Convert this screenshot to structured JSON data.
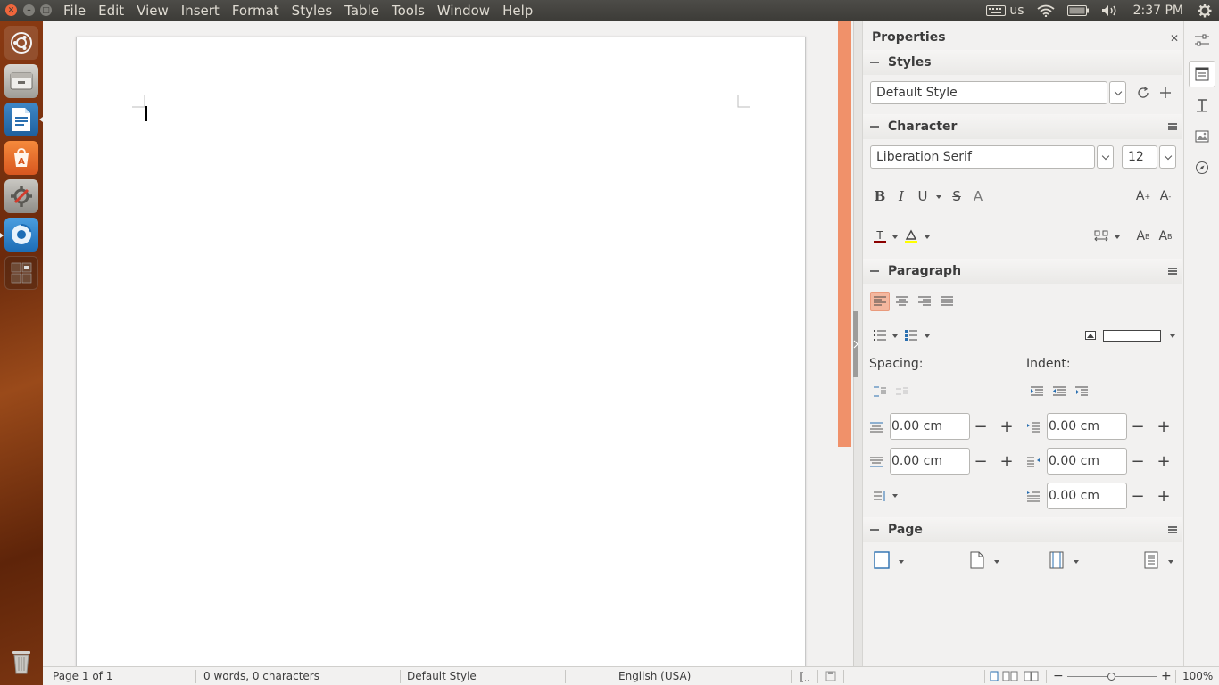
{
  "menubar": {
    "items": [
      "File",
      "Edit",
      "View",
      "Insert",
      "Format",
      "Styles",
      "Table",
      "Tools",
      "Window",
      "Help"
    ]
  },
  "indicators": {
    "keyboard_layout": "us",
    "clock": "2:37 PM"
  },
  "launcher": {
    "icons": [
      "ubuntu-dash-icon",
      "files-icon",
      "writer-icon",
      "software-center-icon",
      "system-settings-icon",
      "browser-icon",
      "workspace-switcher-icon",
      "trash-icon"
    ]
  },
  "sidebar": {
    "title": "Properties",
    "styles": {
      "header": "Styles",
      "value": "Default Style"
    },
    "character": {
      "header": "Character",
      "font": "Liberation Serif",
      "size": "12"
    },
    "paragraph": {
      "header": "Paragraph",
      "spacing_label": "Spacing:",
      "indent_label": "Indent:",
      "above_spacing": "0.00 cm",
      "below_spacing": "0.00 cm",
      "before_indent": "0.00 cm",
      "after_indent": "0.00 cm",
      "first_line_indent": "0.00 cm"
    },
    "page": {
      "header": "Page"
    }
  },
  "statusbar": {
    "page": "Page 1 of 1",
    "word_count": "0 words, 0 characters",
    "page_style": "Default Style",
    "language": "English (USA)",
    "zoom": "100%",
    "zoom_level": 1.0
  },
  "colors": {
    "accent": "#f0916a",
    "active_tool": "#f4b79e",
    "font_color": "#8b0000",
    "highlight_color": "#ffff00"
  }
}
